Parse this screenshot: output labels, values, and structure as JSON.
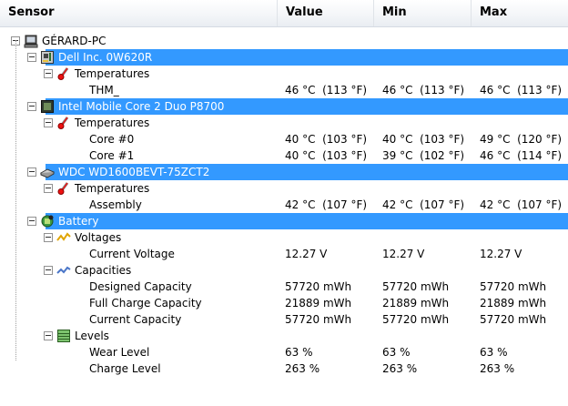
{
  "columns": [
    "Sensor",
    "Value",
    "Min",
    "Max"
  ],
  "tree": {
    "root": "GÉRARD-PC",
    "devices": [
      {
        "name": "Dell Inc. 0W620R",
        "icon": "motherboard-icon",
        "groups": [
          {
            "name": "Temperatures",
            "icon": "thermometer-icon",
            "items": [
              {
                "name": "THM_",
                "value": "46 °C  (113 °F)",
                "min": "46 °C  (113 °F)",
                "max": "46 °C  (113 °F)"
              }
            ]
          }
        ]
      },
      {
        "name": "Intel Mobile Core 2 Duo P8700",
        "icon": "cpu-icon",
        "groups": [
          {
            "name": "Temperatures",
            "icon": "thermometer-icon",
            "items": [
              {
                "name": "Core #0",
                "value": "40 °C  (103 °F)",
                "min": "40 °C  (103 °F)",
                "max": "49 °C  (120 °F)"
              },
              {
                "name": "Core #1",
                "value": "40 °C  (103 °F)",
                "min": "39 °C  (102 °F)",
                "max": "46 °C  (114 °F)"
              }
            ]
          }
        ]
      },
      {
        "name": "WDC WD1600BEVT-75ZCT2",
        "icon": "hard-drive-icon",
        "groups": [
          {
            "name": "Temperatures",
            "icon": "thermometer-icon",
            "items": [
              {
                "name": "Assembly",
                "value": "42 °C  (107 °F)",
                "min": "42 °C  (107 °F)",
                "max": "42 °C  (107 °F)"
              }
            ]
          }
        ]
      },
      {
        "name": "Battery",
        "icon": "battery-icon",
        "groups": [
          {
            "name": "Voltages",
            "icon": "voltage-icon",
            "items": [
              {
                "name": "Current Voltage",
                "value": "12.27 V",
                "min": "12.27 V",
                "max": "12.27 V"
              }
            ]
          },
          {
            "name": "Capacities",
            "icon": "capacity-icon",
            "items": [
              {
                "name": "Designed Capacity",
                "value": "57720 mWh",
                "min": "57720 mWh",
                "max": "57720 mWh"
              },
              {
                "name": "Full Charge Capacity",
                "value": "21889 mWh",
                "min": "21889 mWh",
                "max": "21889 mWh"
              },
              {
                "name": "Current Capacity",
                "value": "57720 mWh",
                "min": "57720 mWh",
                "max": "57720 mWh"
              }
            ]
          },
          {
            "name": "Levels",
            "icon": "levels-icon",
            "items": [
              {
                "name": "Wear Level",
                "value": "63 %",
                "min": "63 %",
                "max": "63 %"
              },
              {
                "name": "Charge Level",
                "value": "263 %",
                "min": "263 %",
                "max": "263 %"
              }
            ]
          }
        ]
      }
    ]
  },
  "colors": {
    "highlight": "#3399ff",
    "header_bg": "#f3f5f8"
  }
}
